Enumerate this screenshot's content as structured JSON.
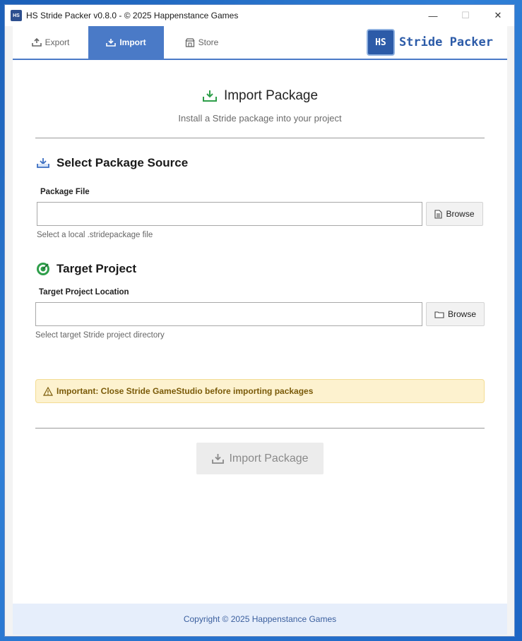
{
  "window": {
    "title": "HS Stride Packer v0.8.0 - © 2025 Happenstance Games",
    "app_icon_text": "HS",
    "controls": {
      "minimize": "—",
      "maximize": "☐",
      "close": "✕"
    }
  },
  "tabs": [
    {
      "label": "Export",
      "icon": "export-icon",
      "active": false
    },
    {
      "label": "Import",
      "icon": "import-icon",
      "active": true
    },
    {
      "label": "Store",
      "icon": "store-icon",
      "active": false
    }
  ],
  "brand": {
    "logo_text": "HS",
    "name": "Stride Packer",
    "color": "#2c5ba8"
  },
  "header": {
    "title": "Import Package",
    "subtitle": "Install a Stride package into your project"
  },
  "source_section": {
    "title": "Select Package Source",
    "field_label": "Package File",
    "input_value": "",
    "browse_label": "Browse",
    "hint": "Select a local .stridepackage file"
  },
  "target_section": {
    "title": "Target Project",
    "field_label": "Target Project Location",
    "input_value": "",
    "browse_label": "Browse",
    "hint": "Select target Stride project directory"
  },
  "warning": {
    "text": "Important: Close Stride GameStudio before importing packages",
    "icon": "warning-icon"
  },
  "import_button": {
    "label": "Import Package",
    "enabled": false
  },
  "footer": {
    "text": "Copyright © 2025 Happenstance Games"
  },
  "colors": {
    "accent": "#4a7ac7",
    "success_green": "#2e9e4a",
    "warning_bg": "#fdf2cf",
    "warning_text": "#7a5a08"
  }
}
